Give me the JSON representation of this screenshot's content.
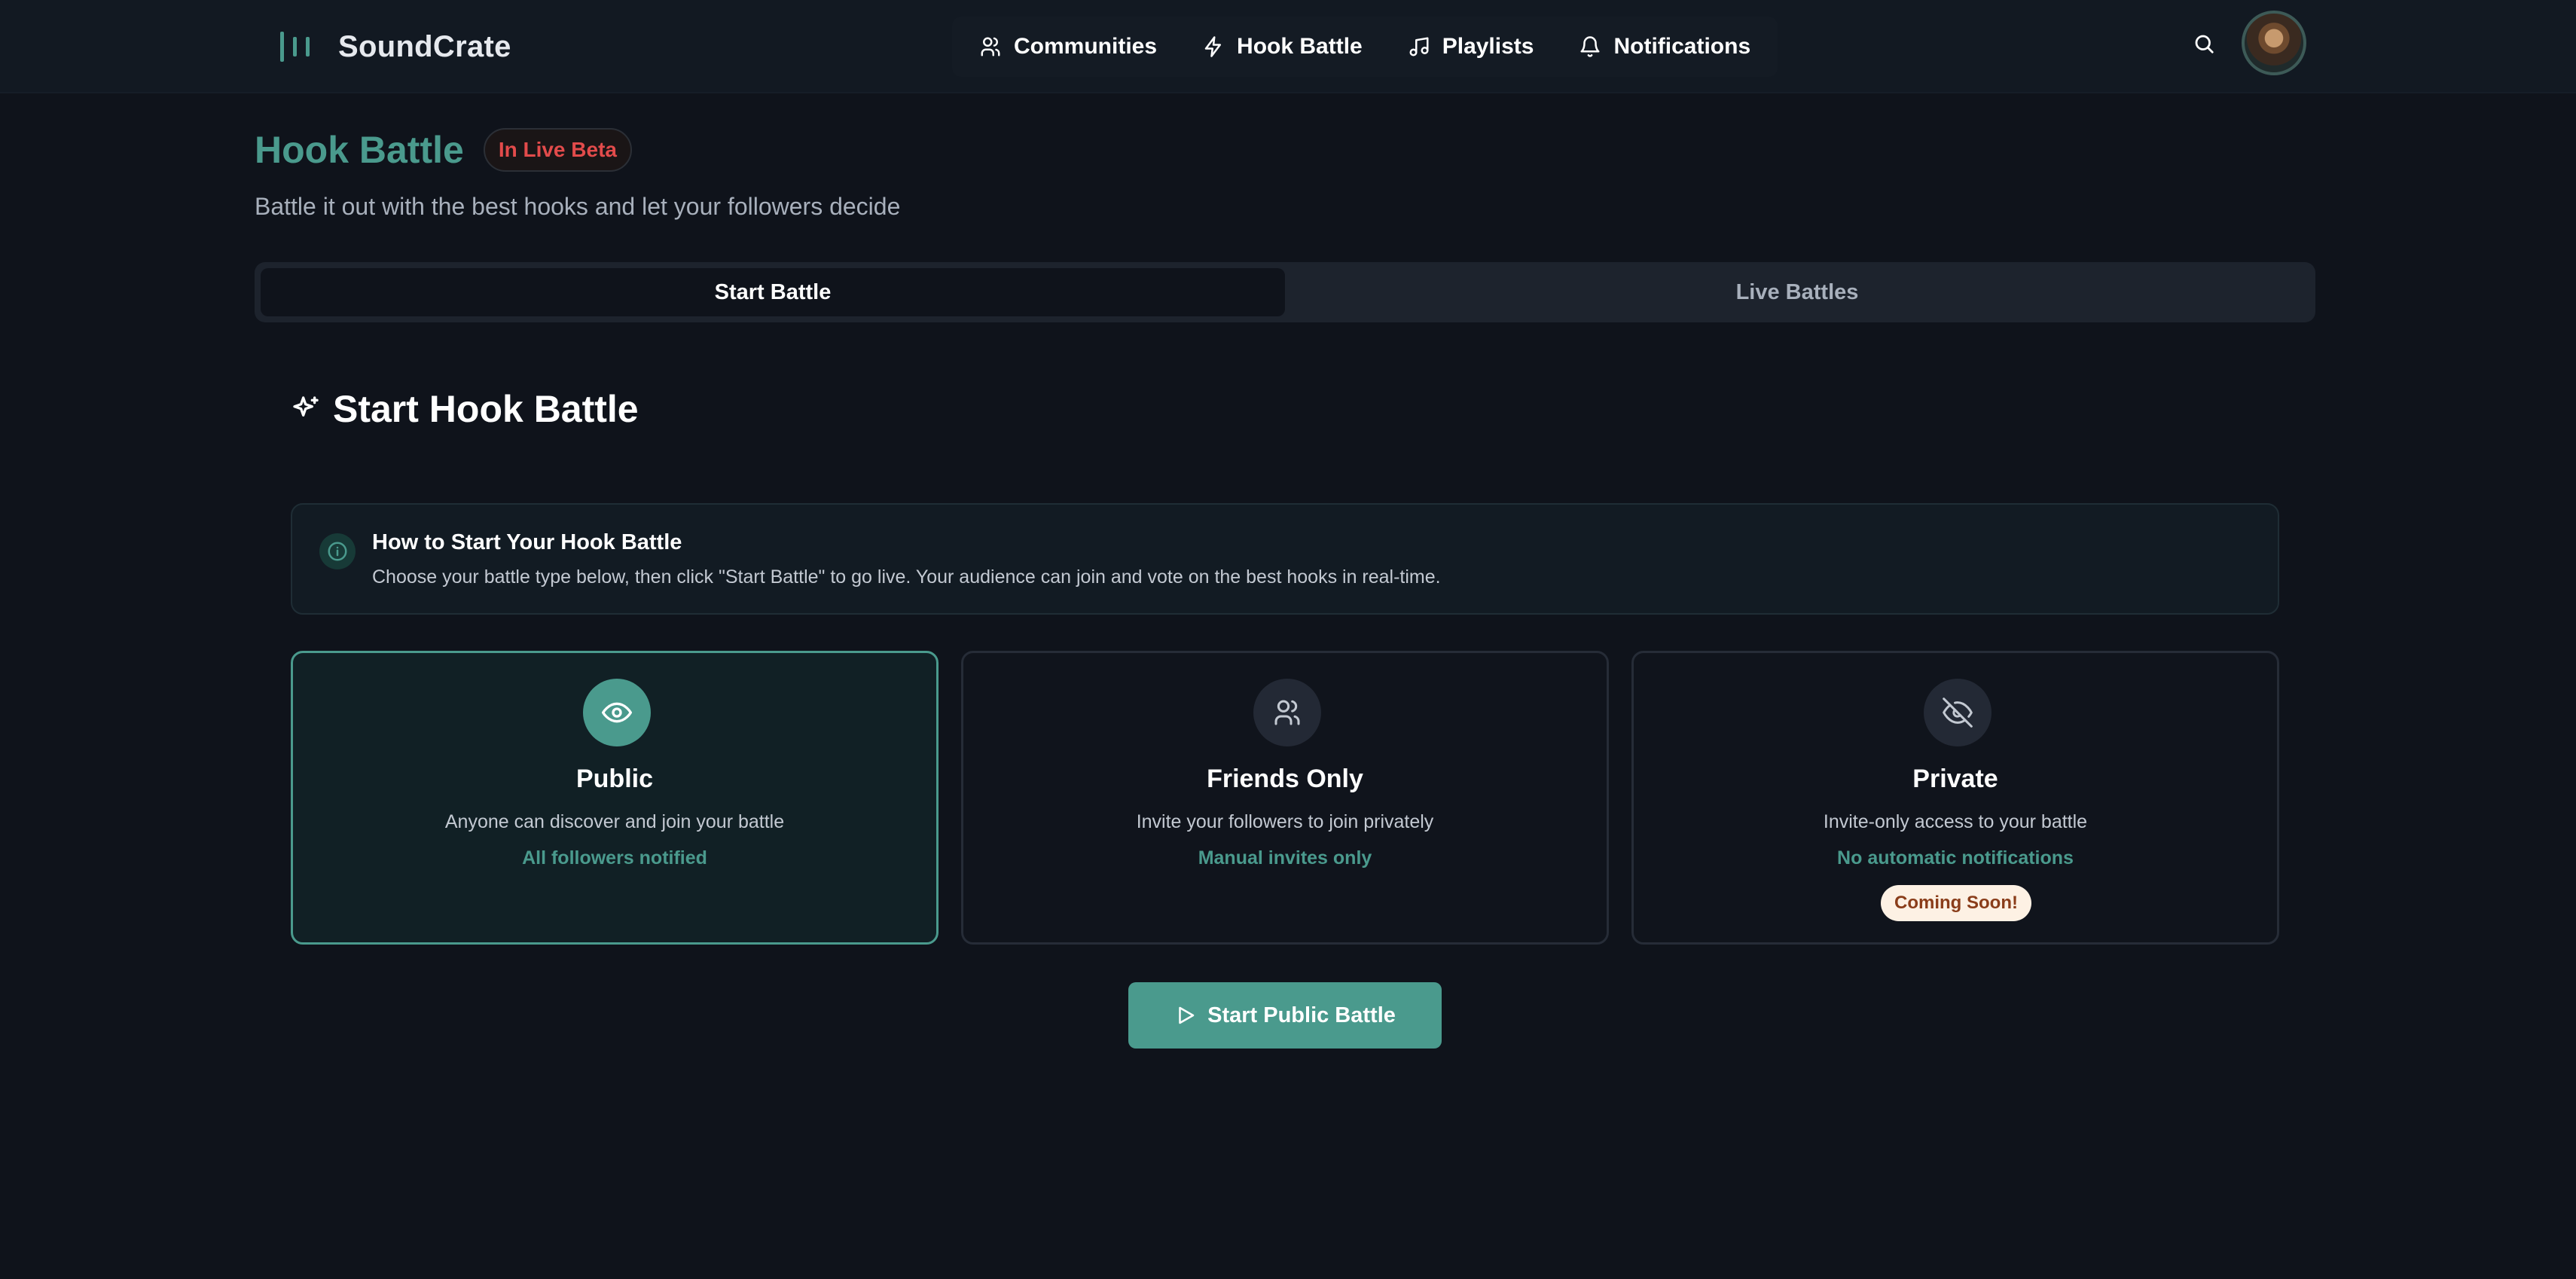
{
  "app": {
    "name": "SoundCrate"
  },
  "nav": {
    "items": [
      {
        "label": "Communities",
        "icon": "users-icon"
      },
      {
        "label": "Hook Battle",
        "icon": "zap-icon"
      },
      {
        "label": "Playlists",
        "icon": "music-note-icon"
      },
      {
        "label": "Notifications",
        "icon": "bell-icon"
      }
    ]
  },
  "page": {
    "title": "Hook Battle",
    "badge": "In Live Beta",
    "subtitle": "Battle it out with the best hooks and let your followers decide"
  },
  "tabs": [
    {
      "label": "Start Battle",
      "active": true
    },
    {
      "label": "Live Battles",
      "active": false
    }
  ],
  "section": {
    "title": "Start Hook Battle",
    "icon": "sparkles-icon"
  },
  "info": {
    "title": "How to Start Your Hook Battle",
    "text": "Choose your battle type below, then click \"Start Battle\" to go live. Your audience can join and vote on the best hooks in real-time."
  },
  "options": [
    {
      "title": "Public",
      "description": "Anyone can discover and join your battle",
      "note": "All followers notified",
      "icon": "eye-icon",
      "selected": true
    },
    {
      "title": "Friends Only",
      "description": "Invite your followers to join privately",
      "note": "Manual invites only",
      "icon": "users-icon",
      "selected": false
    },
    {
      "title": "Private",
      "description": "Invite-only access to your battle",
      "note": "No automatic notifications",
      "icon": "eye-off-icon",
      "selected": false,
      "badge": "Coming Soon!"
    }
  ],
  "start_button": {
    "label": "Start Public Battle",
    "icon": "play-icon"
  },
  "colors": {
    "accent": "#4a9a8d",
    "background": "#0f131b",
    "beta_red": "#e24b4b",
    "soon_bg": "#fdf1e4",
    "soon_text": "#8a3d1a"
  }
}
